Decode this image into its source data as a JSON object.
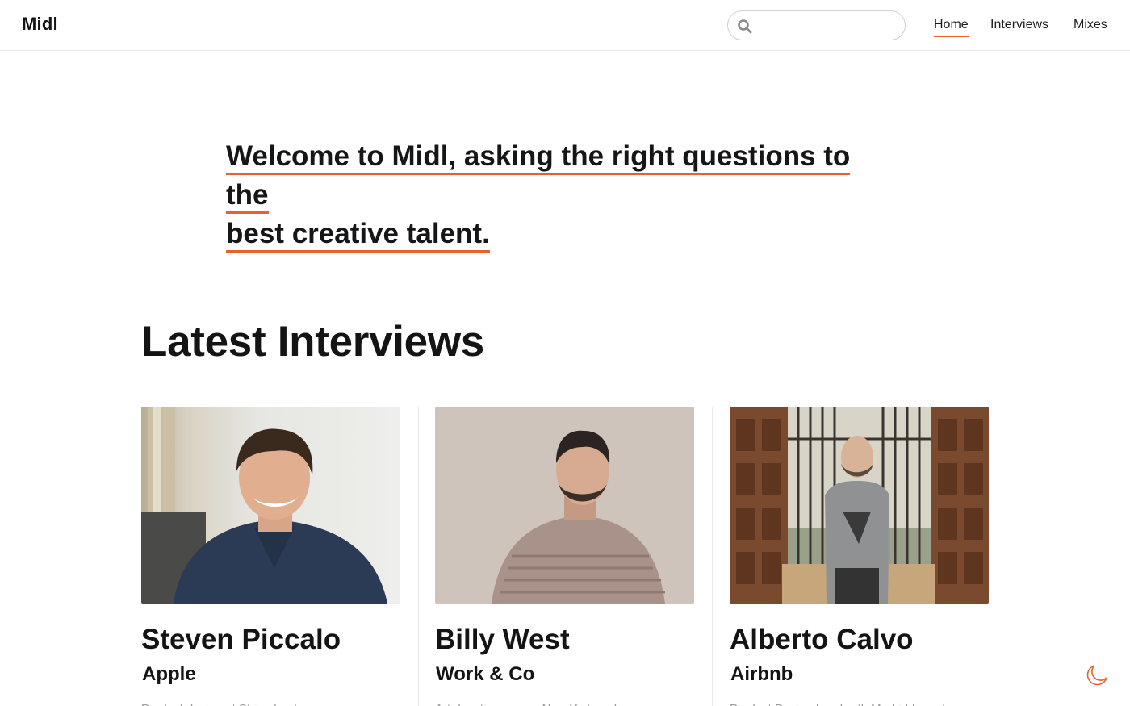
{
  "header": {
    "logo": "Midl",
    "search": {
      "placeholder": "",
      "value": ""
    },
    "nav": [
      {
        "label": "Home",
        "active": true
      },
      {
        "label": "Interviews",
        "active": false
      },
      {
        "label": "Mixes",
        "active": false
      }
    ]
  },
  "hero": {
    "line1": "Welcome to Midl, asking the right questions to the",
    "line2": "best creative talent."
  },
  "latest": {
    "title": "Latest Interviews",
    "cards": [
      {
        "name": "Steven Piccalo",
        "company": "Apple",
        "excerpt": "Product design at Stripe lead..."
      },
      {
        "name": "Billy West",
        "company": "Work & Co",
        "excerpt": "Art direction across New York and..."
      },
      {
        "name": "Alberto Calvo",
        "company": "Airbnb",
        "excerpt": "Product Design Lead with Madrid-based..."
      }
    ]
  },
  "colors": {
    "accent": "#e8612c",
    "text": "#141414",
    "border": "#e6e6e6"
  },
  "icons": {
    "search": "search-icon",
    "theme": "moon-icon"
  }
}
